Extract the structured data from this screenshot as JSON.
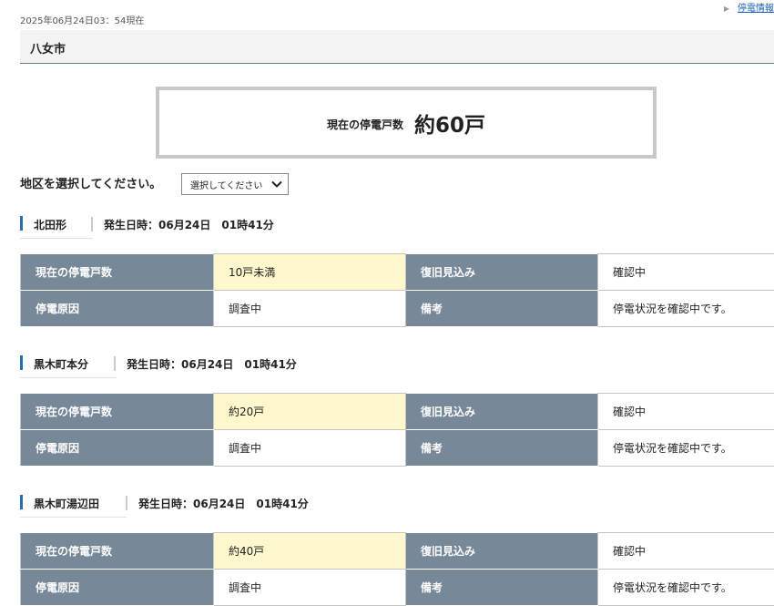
{
  "header": {
    "timestamp": "2025年06月24日03：54現在",
    "top_link": "停電情報"
  },
  "city": {
    "name": "八女市"
  },
  "summary": {
    "label": "現在の停電戸数",
    "value": "約60戸"
  },
  "area_select": {
    "label": "地区を選択してください。",
    "selected": "選択してください"
  },
  "table_labels": {
    "current": "現在の停電戸数",
    "restore": "復旧見込み",
    "cause": "停電原因",
    "note": "備考"
  },
  "sections": [
    {
      "name": "北田形",
      "occurred": "発生日時：06月24日　01時41分",
      "current": "10戸未満",
      "restore": "確認中",
      "cause": "調査中",
      "note": "停電状況を確認中です。"
    },
    {
      "name": "黒木町本分",
      "occurred": "発生日時：06月24日　01時41分",
      "current": "約20戸",
      "restore": "確認中",
      "cause": "調査中",
      "note": "停電状況を確認中です。"
    },
    {
      "name": "黒木町湯辺田",
      "occurred": "発生日時：06月24日　01時41分",
      "current": "約40戸",
      "restore": "確認中",
      "cause": "調査中",
      "note": "停電状況を確認中です。"
    }
  ],
  "colors": {
    "label_cell": "#778899",
    "highlight_cell": "#fff8cc",
    "accent_bar": "#2a6db0"
  }
}
